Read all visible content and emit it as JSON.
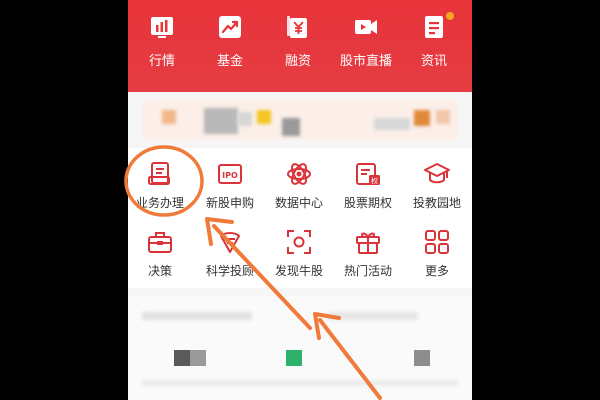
{
  "top_nav": {
    "items": [
      {
        "label": "行情",
        "icon": "bar-chart-icon"
      },
      {
        "label": "基金",
        "icon": "trend-chart-icon"
      },
      {
        "label": "融资",
        "icon": "yen-document-icon"
      },
      {
        "label": "股市直播",
        "icon": "video-play-icon"
      },
      {
        "label": "资讯",
        "icon": "news-document-icon"
      }
    ]
  },
  "features": {
    "row1": [
      {
        "label": "业务办理",
        "icon": "business-handling-icon"
      },
      {
        "label": "新股申购",
        "icon": "ipo-icon"
      },
      {
        "label": "数据中心",
        "icon": "atom-icon"
      },
      {
        "label": "股票期权",
        "icon": "stock-options-icon"
      },
      {
        "label": "投教园地",
        "icon": "graduation-cap-icon"
      }
    ],
    "row2": [
      {
        "label": "决策",
        "icon": "toolbox-icon"
      },
      {
        "label": "科学投顾",
        "icon": "advisor-icon"
      },
      {
        "label": "发现牛股",
        "icon": "scan-target-icon"
      },
      {
        "label": "热门活动",
        "icon": "gift-icon"
      },
      {
        "label": "更多",
        "icon": "grid-more-icon"
      }
    ]
  },
  "colors": {
    "brand_red": "#e8333a",
    "icon_red": "#d9343a",
    "annotation_orange": "#f07a3a",
    "notification": "#f5a623"
  }
}
